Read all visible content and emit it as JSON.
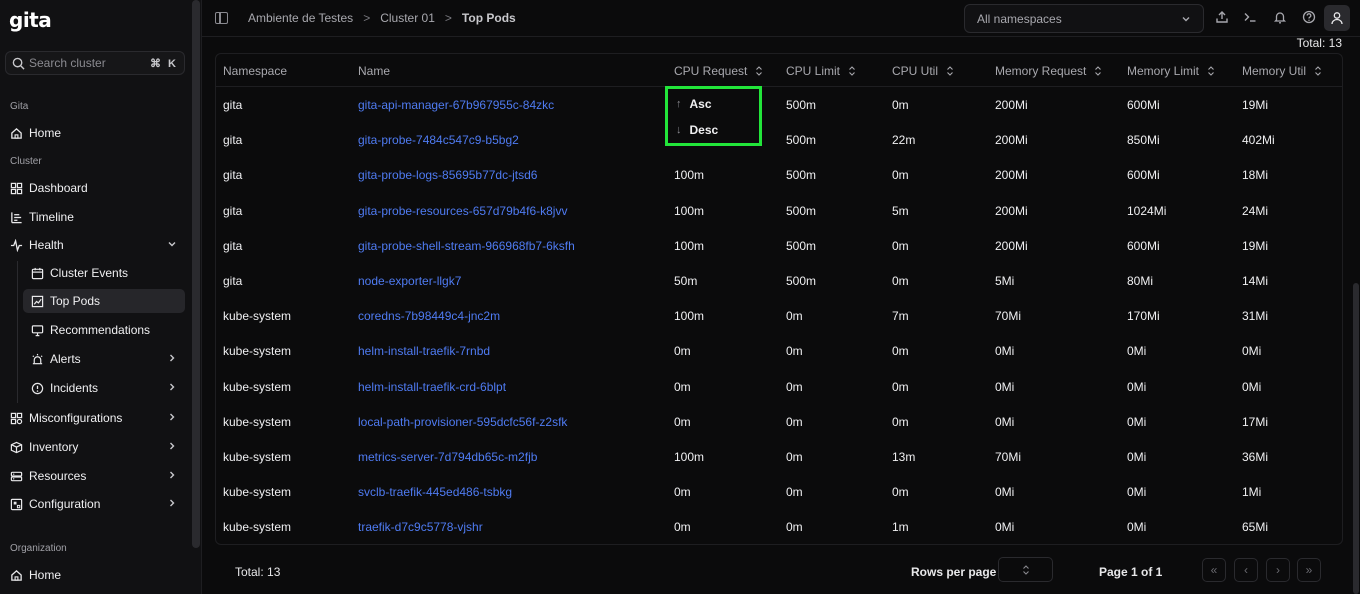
{
  "app": {
    "logo": "gita"
  },
  "sidebar": {
    "search_placeholder": "Search cluster",
    "search_shortcut": "⌘ K",
    "section_gita": "Gita",
    "home": "Home",
    "section_cluster": "Cluster",
    "dashboard": "Dashboard",
    "timeline": "Timeline",
    "health": "Health",
    "cluster_events": "Cluster Events",
    "top_pods": "Top Pods",
    "recommendations": "Recommendations",
    "alerts": "Alerts",
    "incidents": "Incidents",
    "misconfigurations": "Misconfigurations",
    "inventory": "Inventory",
    "resources": "Resources",
    "configuration": "Configuration",
    "section_org": "Organization",
    "org_home": "Home"
  },
  "breadcrumb": {
    "item1": "Ambiente de Testes",
    "item2": "Cluster 01",
    "current": "Top Pods",
    "sep": ">"
  },
  "namespace_select": {
    "value": "All namespaces"
  },
  "table": {
    "total_label": "Total: 13",
    "columns": [
      "Namespace",
      "Name",
      "CPU Request",
      "CPU Limit",
      "CPU Util",
      "Memory Request",
      "Memory Limit",
      "Memory Util"
    ],
    "rows": [
      [
        "gita",
        "gita-api-manager-67b967955c-84zkc",
        "",
        "500m",
        "0m",
        "200Mi",
        "600Mi",
        "19Mi"
      ],
      [
        "gita",
        "gita-probe-7484c547c9-b5bg2",
        "",
        "500m",
        "22m",
        "200Mi",
        "850Mi",
        "402Mi"
      ],
      [
        "gita",
        "gita-probe-logs-85695b77dc-jtsd6",
        "100m",
        "500m",
        "0m",
        "200Mi",
        "600Mi",
        "18Mi"
      ],
      [
        "gita",
        "gita-probe-resources-657d79b4f6-k8jvv",
        "100m",
        "500m",
        "5m",
        "200Mi",
        "1024Mi",
        "24Mi"
      ],
      [
        "gita",
        "gita-probe-shell-stream-966968fb7-6ksfh",
        "100m",
        "500m",
        "0m",
        "200Mi",
        "600Mi",
        "19Mi"
      ],
      [
        "gita",
        "node-exporter-llgk7",
        "50m",
        "500m",
        "0m",
        "5Mi",
        "80Mi",
        "14Mi"
      ],
      [
        "kube-system",
        "coredns-7b98449c4-jnc2m",
        "100m",
        "0m",
        "7m",
        "70Mi",
        "170Mi",
        "31Mi"
      ],
      [
        "kube-system",
        "helm-install-traefik-7rnbd",
        "0m",
        "0m",
        "0m",
        "0Mi",
        "0Mi",
        "0Mi"
      ],
      [
        "kube-system",
        "helm-install-traefik-crd-6blpt",
        "0m",
        "0m",
        "0m",
        "0Mi",
        "0Mi",
        "0Mi"
      ],
      [
        "kube-system",
        "local-path-provisioner-595dcfc56f-z2sfk",
        "0m",
        "0m",
        "0m",
        "0Mi",
        "0Mi",
        "17Mi"
      ],
      [
        "kube-system",
        "metrics-server-7d794db65c-m2fjb",
        "100m",
        "0m",
        "13m",
        "70Mi",
        "0Mi",
        "36Mi"
      ],
      [
        "kube-system",
        "svclb-traefik-445ed486-tsbkg",
        "0m",
        "0m",
        "0m",
        "0Mi",
        "0Mi",
        "1Mi"
      ],
      [
        "kube-system",
        "traefik-d7c9c5778-vjshr",
        "0m",
        "0m",
        "1m",
        "0Mi",
        "0Mi",
        "65Mi"
      ]
    ]
  },
  "sort_menu": {
    "asc": "Asc",
    "desc": "Desc",
    "asc_arrow": "↑",
    "desc_arrow": "↓"
  },
  "footer": {
    "total": "Total: 13",
    "rows_per_page_label": "Rows per page",
    "page_label": "Page 1 of 1",
    "first": "«",
    "prev": "‹",
    "next": "›",
    "last": "»"
  },
  "colors": {
    "highlight": "#22e53a",
    "link": "#4f7bf2"
  }
}
